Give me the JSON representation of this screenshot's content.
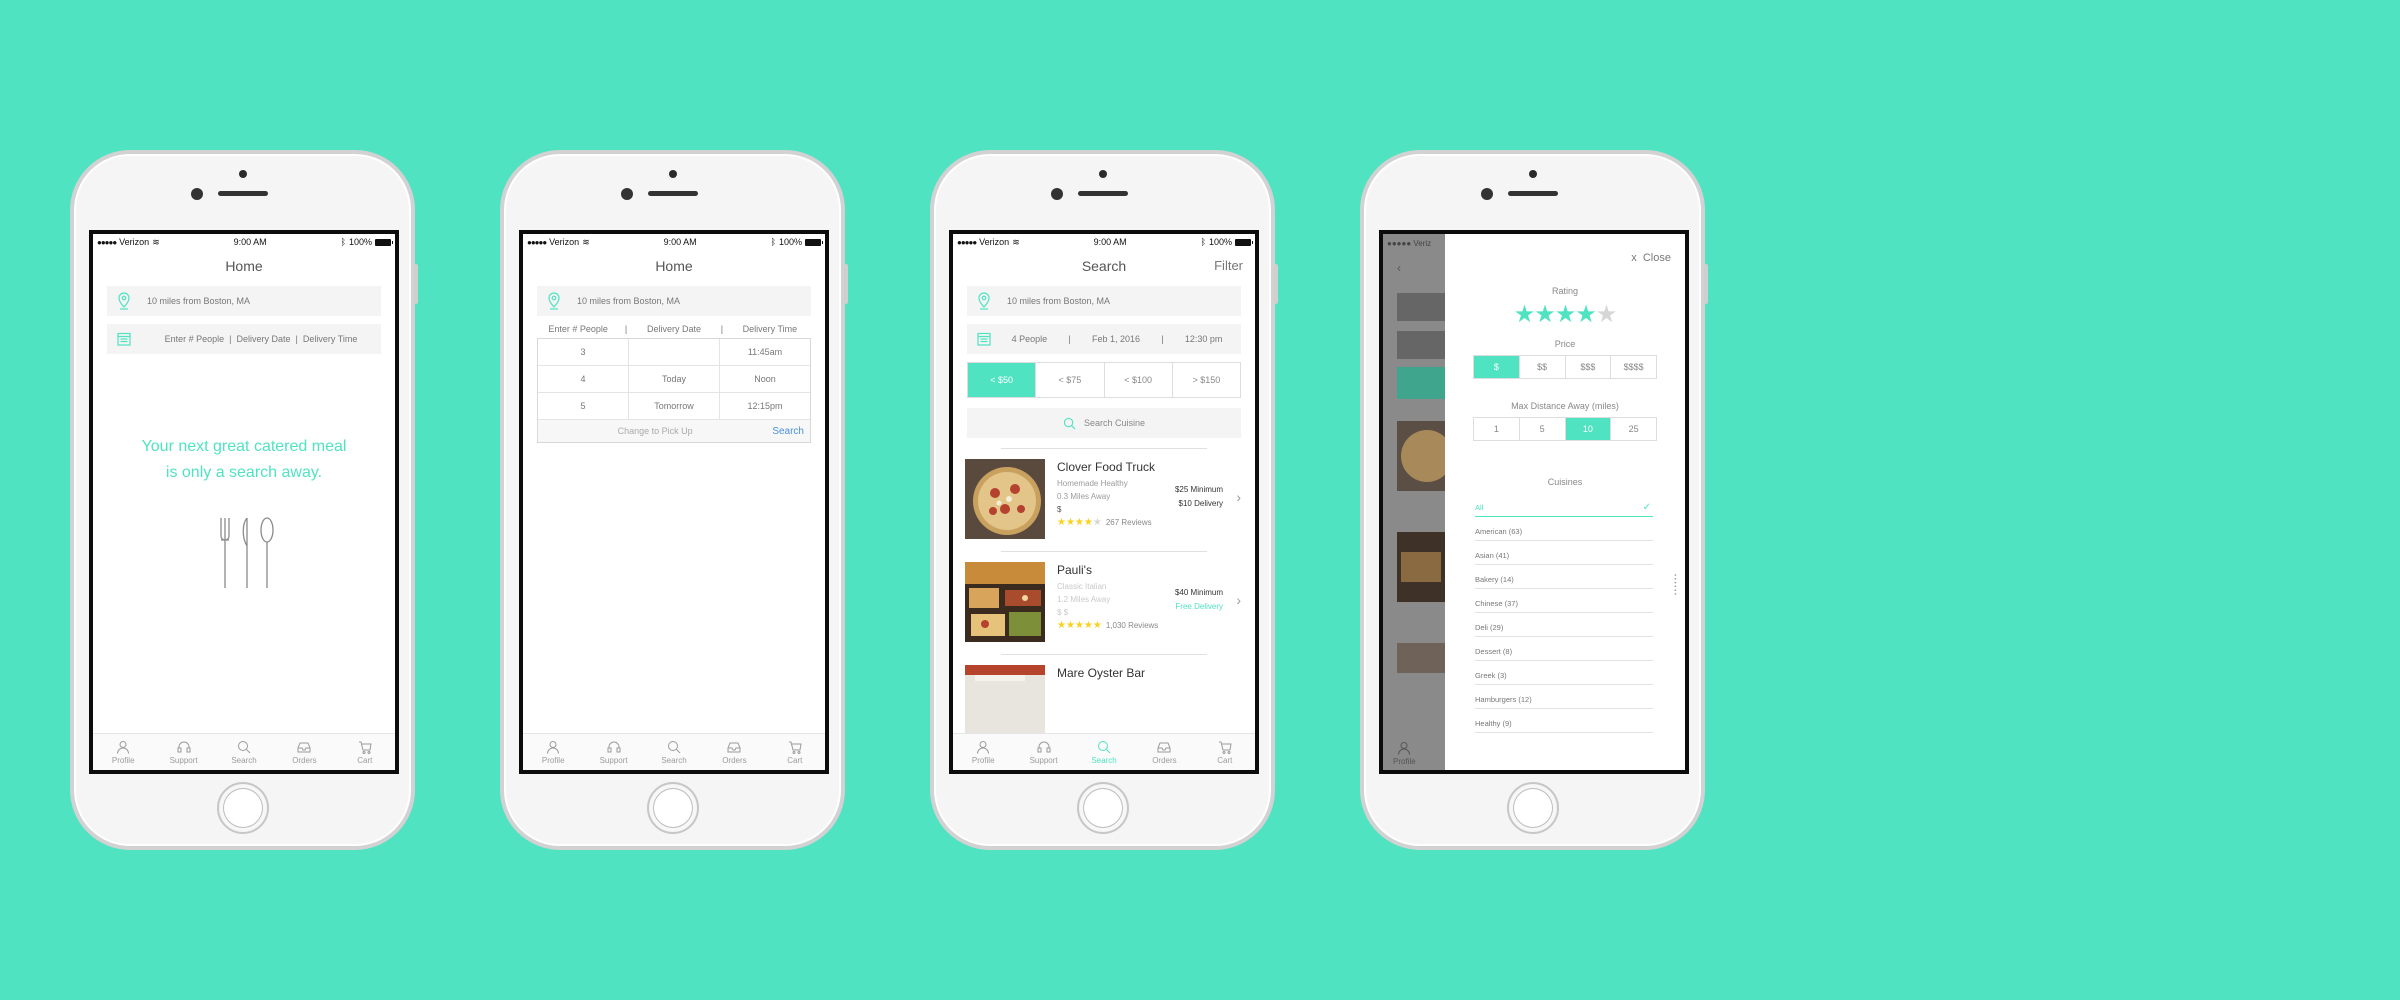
{
  "colors": {
    "accent": "#50e3c2",
    "background": "#50e3c2",
    "star": "#f8d21c",
    "link": "#4a90e2"
  },
  "status": {
    "carrier": "Verizon",
    "time": "9:00 AM",
    "battery": "100%"
  },
  "tabs": [
    "Profile",
    "Support",
    "Search",
    "Orders",
    "Cart"
  ],
  "screen1": {
    "title": "Home",
    "location": "10 miles from Boston, MA",
    "details_placeholder": "Enter # People  |  Delivery Date  |  Delivery Time",
    "hero_line1": "Your next great catered meal",
    "hero_line2": "is only a search away."
  },
  "screen2": {
    "title": "Home",
    "location": "10 miles from Boston, MA",
    "headers": [
      "Enter # People",
      "|",
      "Delivery Date",
      "|",
      "Delivery Time"
    ],
    "rows": [
      [
        "3",
        "",
        "11:45am"
      ],
      [
        "4",
        "Today",
        "Noon"
      ],
      [
        "5",
        "Tomorrow",
        "12:15pm"
      ]
    ],
    "change_label": "Change to Pick Up",
    "search_label": "Search"
  },
  "screen3": {
    "title": "Search",
    "filter_label": "Filter",
    "location": "10 miles from Boston, MA",
    "people": "4 People",
    "date": "Feb 1, 2016",
    "time": "12:30 pm",
    "sep": "|",
    "price_tabs": [
      "< $50",
      "< $75",
      "< $100",
      "> $150"
    ],
    "search_placeholder": "Search Cuisine",
    "restaurants": [
      {
        "name": "Clover Food Truck",
        "category": "Homemade Healthy",
        "distance": "0.3 Miles Away",
        "price_level": "$",
        "rating": 4,
        "reviews": "267 Reviews",
        "minimum": "$25 Minimum",
        "delivery": "$10 Delivery"
      },
      {
        "name": "Pauli's",
        "category": "Classic Italian",
        "distance": "1.2 Miles Away",
        "price_level": "$ $",
        "rating": 5,
        "reviews": "1,030 Reviews",
        "minimum": "$40 Minimum",
        "delivery": "Free Delivery"
      },
      {
        "name": "Mare Oyster Bar"
      }
    ]
  },
  "screen4": {
    "close_label": "x  Close",
    "rating_label": "Rating",
    "rating_value": 4,
    "price_label": "Price",
    "price_options": [
      "$",
      "$$",
      "$$$",
      "$$$$"
    ],
    "distance_label": "Max Distance Away (miles)",
    "distance_options": [
      "1",
      "5",
      "10",
      "25"
    ],
    "cuisines_label": "Cuisines",
    "cuisines": [
      "All",
      "American (63)",
      "Asian (41)",
      "Bakery (14)",
      "Chinese (37)",
      "Deli (29)",
      "Dessert (8)",
      "Greek (3)",
      "Hamburgers (12)",
      "Healthy (9)"
    ],
    "bg_tab": "Profile",
    "bg_status": "Veriz"
  }
}
